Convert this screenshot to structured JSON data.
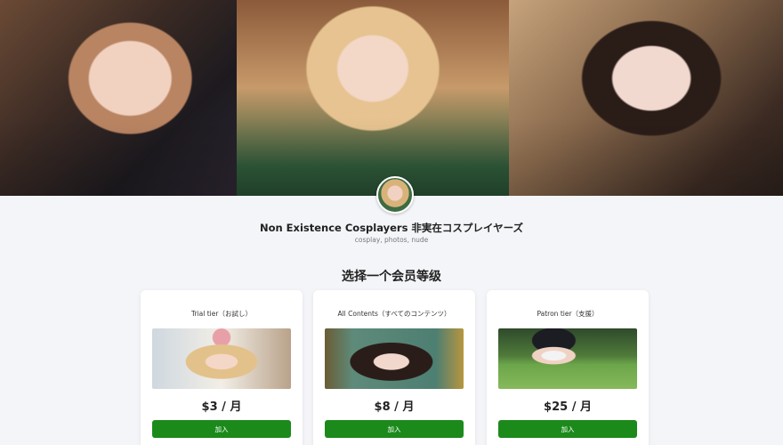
{
  "creator": {
    "name": "Non Existence Cosplayers 非実在コスプレイヤーズ",
    "tags": "cosplay, photos, nude"
  },
  "tiers_section": {
    "title": "选择一个会员等级"
  },
  "tiers": [
    {
      "name": "Trial tier（お試し）",
      "price": "$3 / 月",
      "join_label": "加入"
    },
    {
      "name": "All Contents（すべてのコンテンツ）",
      "price": "$8 / 月",
      "join_label": "加入"
    },
    {
      "name": "Patron tier（支援）",
      "price": "$25 / 月",
      "join_label": "加入"
    }
  ],
  "colors": {
    "page_background": "#f4f5f8",
    "join_button": "#1b8a1b"
  }
}
